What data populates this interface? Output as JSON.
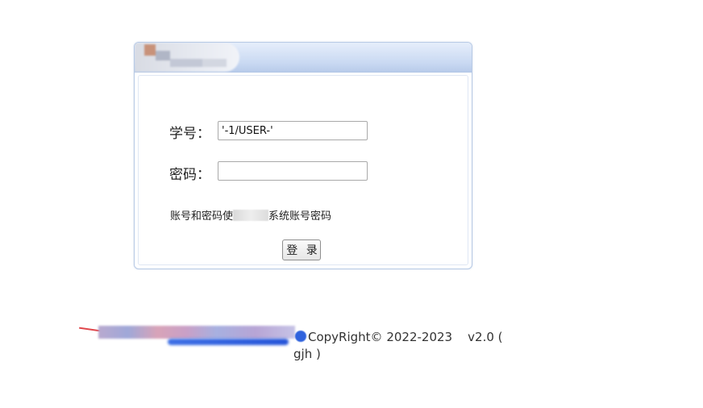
{
  "login": {
    "student_id_label": "学号：",
    "student_id_value": "'-1/USER-'",
    "password_label": "密码：",
    "password_value": "",
    "note_prefix": "账号和密码使",
    "note_suffix": "系统账号密码",
    "login_button": "登 录"
  },
  "footer": {
    "copyright": "CopyRight© 2022-2023",
    "version": "v2.0 ( gjh )"
  },
  "colors": {
    "panel_border": "#b9cbe6",
    "header_top": "#e6eefb",
    "header_bottom": "#b8cbea"
  }
}
